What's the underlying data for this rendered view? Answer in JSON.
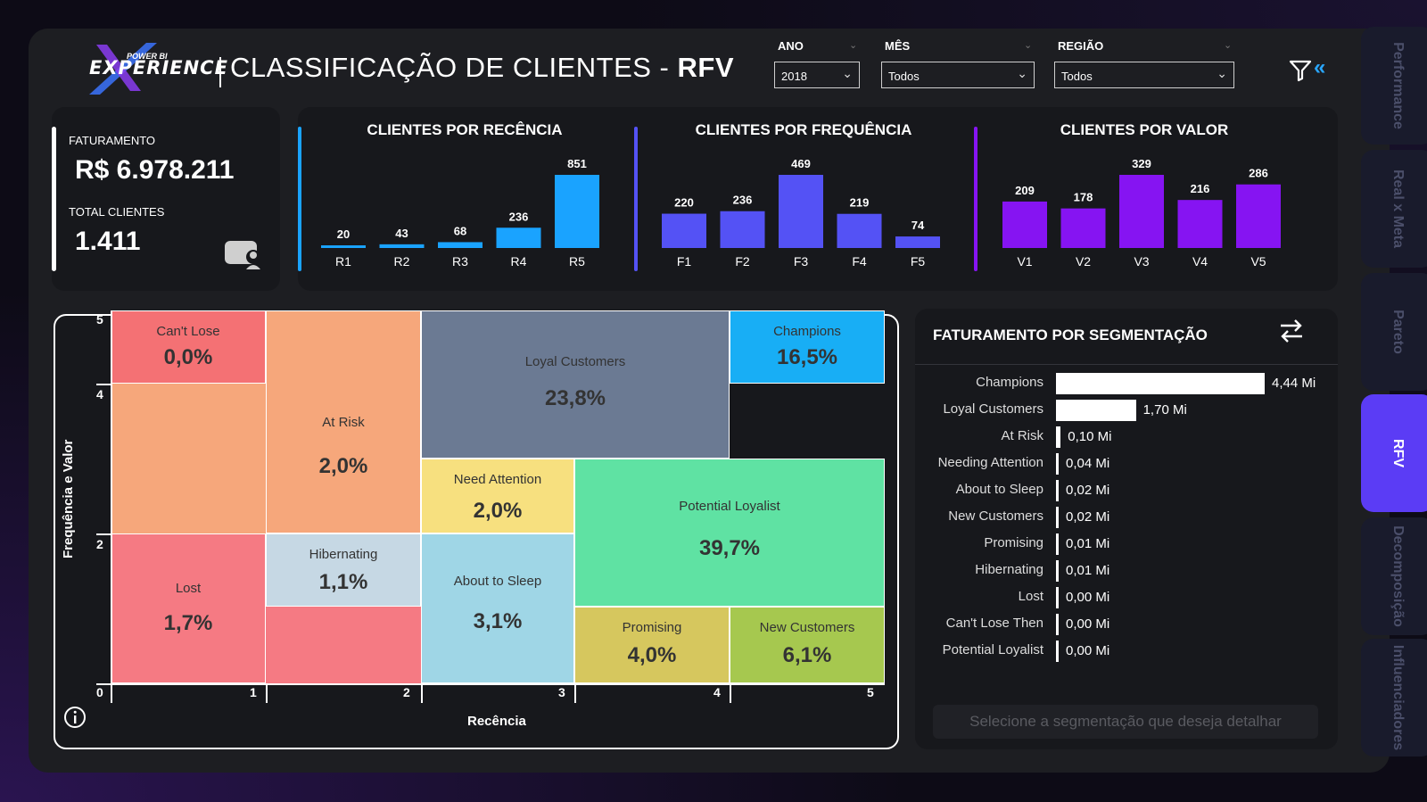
{
  "header": {
    "logo_small": "POWER BI",
    "logo_text": "EXPERIENCE",
    "title_prefix": "CLASSIFICAÇÃO DE CLIENTES - ",
    "title_bold": "RFV"
  },
  "slicers": [
    {
      "label": "ANO",
      "value": "2018"
    },
    {
      "label": "MÊS",
      "value": "Todos"
    },
    {
      "label": "REGIÃO",
      "value": "Todos"
    }
  ],
  "kpis": {
    "revenue_label": "FATURAMENTO",
    "revenue_value": "R$ 6.978.211",
    "clients_label": "TOTAL CLIENTES",
    "clients_value": "1.411"
  },
  "chart_data": [
    {
      "type": "bar",
      "title": "CLIENTES POR RECÊNCIA",
      "categories": [
        "R1",
        "R2",
        "R3",
        "R4",
        "R5"
      ],
      "values": [
        20,
        43,
        68,
        236,
        851
      ],
      "color": "#1aa3ff"
    },
    {
      "type": "bar",
      "title": "CLIENTES POR FREQUÊNCIA",
      "categories": [
        "F1",
        "F2",
        "F3",
        "F4",
        "F5"
      ],
      "values": [
        220,
        236,
        469,
        219,
        74
      ],
      "color": "#5452f5"
    },
    {
      "type": "bar",
      "title": "CLIENTES POR VALOR",
      "categories": [
        "V1",
        "V2",
        "V3",
        "V4",
        "V5"
      ],
      "values": [
        209,
        178,
        329,
        216,
        286
      ],
      "color": "#8614f2"
    }
  ],
  "treemap": {
    "ylabel": "Frequência e Valor",
    "xlabel": "Recência",
    "yticks": [
      "5",
      "4",
      "2",
      "0"
    ],
    "xticks": [
      "1",
      "2",
      "3",
      "4",
      "5"
    ],
    "segments": [
      {
        "name": "Can't Lose",
        "pct": "0,0%",
        "color": "#f47174"
      },
      {
        "name": "At Risk",
        "pct": "2,0%",
        "color": "#f6a77b"
      },
      {
        "name": "Loyal Customers",
        "pct": "23,8%",
        "color": "#6b7a93"
      },
      {
        "name": "Champions",
        "pct": "16,5%",
        "color": "#18aef5"
      },
      {
        "name": "Need Attention",
        "pct": "2,0%",
        "color": "#f7e07f"
      },
      {
        "name": "Potential Loyalist",
        "pct": "39,7%",
        "color": "#5fe2a3"
      },
      {
        "name": "Lost",
        "pct": "1,7%",
        "color": "#f57a83"
      },
      {
        "name": "Hibernating",
        "pct": "1,1%",
        "color": "#c6d8e4"
      },
      {
        "name": "About to Sleep",
        "pct": "3,1%",
        "color": "#9fd6e6"
      },
      {
        "name": "Promising",
        "pct": "4,0%",
        "color": "#d6c75e"
      },
      {
        "name": "New Customers",
        "pct": "6,1%",
        "color": "#a6c84f"
      }
    ]
  },
  "segmentation": {
    "title": "FATURAMENTO POR SEGMENTAÇÃO",
    "rows": [
      {
        "label": "Champions",
        "value": 4.44,
        "display": "4,44 Mi"
      },
      {
        "label": "Loyal Customers",
        "value": 1.7,
        "display": "1,70 Mi"
      },
      {
        "label": "At Risk",
        "value": 0.1,
        "display": "0,10 Mi"
      },
      {
        "label": "Needing Attention",
        "value": 0.04,
        "display": "0,04 Mi"
      },
      {
        "label": "About to Sleep",
        "value": 0.02,
        "display": "0,02 Mi"
      },
      {
        "label": "New Customers",
        "value": 0.02,
        "display": "0,02 Mi"
      },
      {
        "label": "Promising",
        "value": 0.01,
        "display": "0,01 Mi"
      },
      {
        "label": "Hibernating",
        "value": 0.01,
        "display": "0,01 Mi"
      },
      {
        "label": "Lost",
        "value": 0.0,
        "display": "0,00 Mi"
      },
      {
        "label": "Can't Lose Then",
        "value": 0.0,
        "display": "0,00 Mi"
      },
      {
        "label": "Potential Loyalist",
        "value": 0.0,
        "display": "0,00 Mi"
      }
    ],
    "button": "Selecione a segmentação que deseja detalhar"
  },
  "nav": [
    "Performance",
    "Real x Meta",
    "Pareto",
    "RFV",
    "Decomposição",
    "Influenciadores"
  ],
  "nav_active": "RFV"
}
